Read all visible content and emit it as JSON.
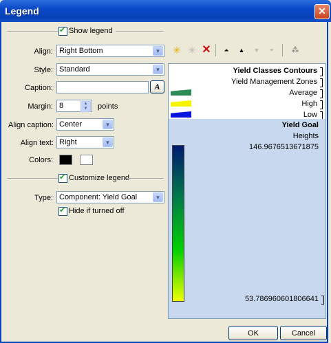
{
  "window": {
    "title": "Legend",
    "close_glyph": "✕"
  },
  "show_legend": {
    "label": "Show legend",
    "checked": true
  },
  "align": {
    "label": "Align:",
    "value": "Right Bottom"
  },
  "style": {
    "label": "Style:",
    "value": "Standard"
  },
  "caption": {
    "label": "Caption:",
    "value": "",
    "font_button": "A"
  },
  "margin": {
    "label": "Margin:",
    "value": "8",
    "unit": "points"
  },
  "align_caption": {
    "label": "Align caption:",
    "value": "Center"
  },
  "align_text": {
    "label": "Align text:",
    "value": "Right"
  },
  "colors": {
    "label": "Colors:",
    "foreground": "#000000",
    "background": "#ffffff"
  },
  "customize_legend": {
    "label": "Customize legend",
    "checked": true
  },
  "type": {
    "label": "Type:",
    "value": "Component: Yield Goal"
  },
  "hide_if_off": {
    "label": "Hide if turned off",
    "checked": true
  },
  "toolbar": {
    "icons": [
      "add-item-icon",
      "add-disabled-icon",
      "delete-icon",
      "move-top-icon",
      "move-up-icon",
      "move-down-icon",
      "move-bottom-icon",
      "tree-icon"
    ]
  },
  "preview": {
    "heading": "Yield Classes Contours",
    "subheading": "Yield Management Zones",
    "items": [
      {
        "label": "Average",
        "color": "#2e8b57"
      },
      {
        "label": "High",
        "color": "#f5f500"
      },
      {
        "label": "Low",
        "color": "#0a14e0"
      }
    ],
    "section_title": "Yield Goal",
    "section_subtitle": "Heights",
    "max_value": "146.9676513671875",
    "min_value": "53.786960601806641",
    "gradient_colors": [
      "#001a70",
      "#007a4a",
      "#00d000",
      "#f0ff00"
    ],
    "selection_color": "#c8d8ef"
  },
  "buttons": {
    "ok": "OK",
    "cancel": "Cancel"
  }
}
